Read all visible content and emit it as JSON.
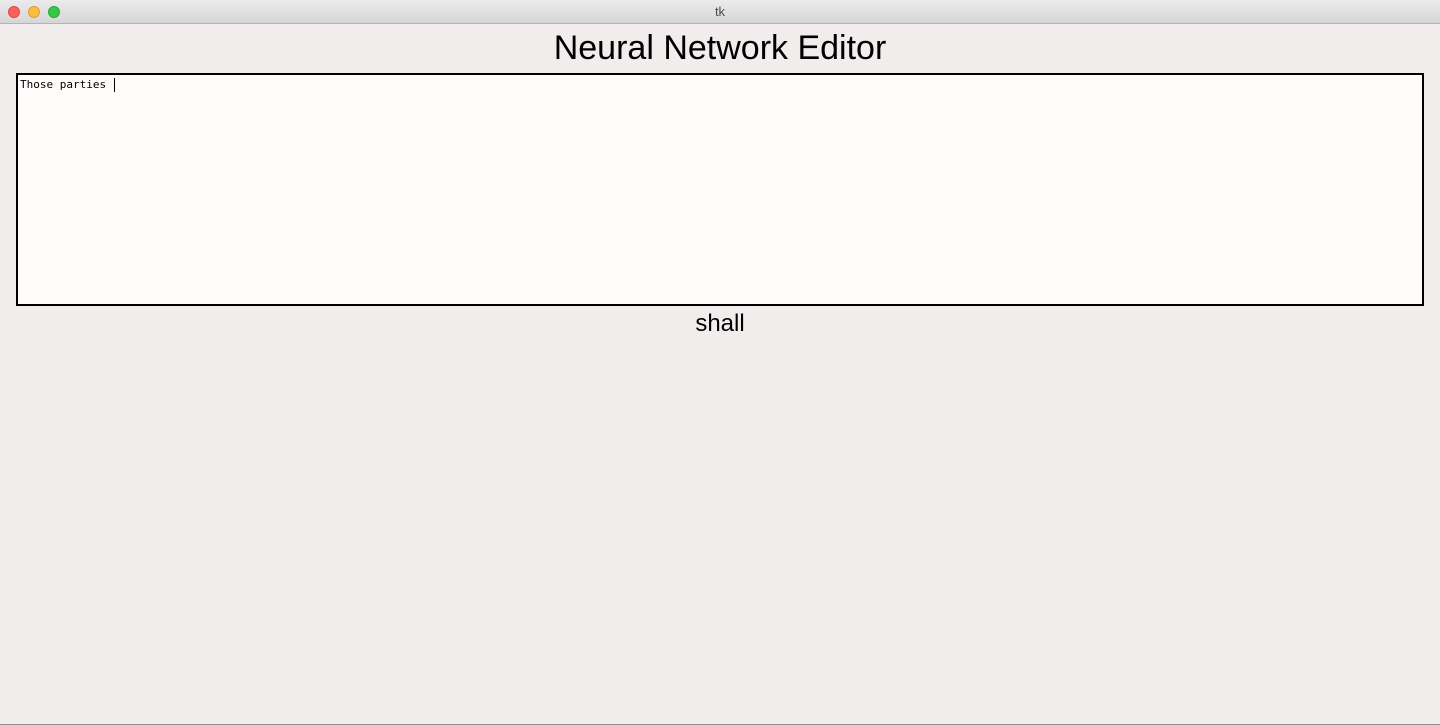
{
  "window": {
    "title": "tk"
  },
  "app": {
    "heading": "Neural Network Editor"
  },
  "editor": {
    "text": "Those parties "
  },
  "prediction": {
    "word": "shall"
  }
}
